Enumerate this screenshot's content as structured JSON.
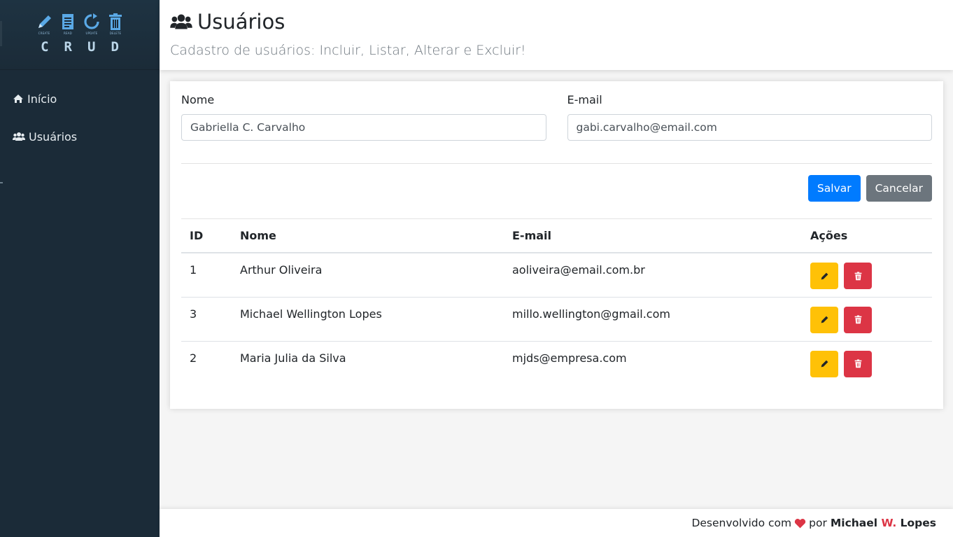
{
  "sidebar": {
    "logo": {
      "letters": [
        "C",
        "R",
        "U",
        "D"
      ],
      "captions": [
        "CREATE",
        "READ",
        "UPDATE",
        "DELETE"
      ]
    },
    "items": [
      {
        "label": "Início",
        "icon": "home-icon"
      },
      {
        "label": "Usuários",
        "icon": "users-icon"
      }
    ]
  },
  "header": {
    "title": "Usuários",
    "subtitle": "Cadastro de usuários: Incluir, Listar, Alterar e Excluir!"
  },
  "form": {
    "name_label": "Nome",
    "name_value": "Gabriella C. Carvalho",
    "email_label": "E-mail",
    "email_value": "gabi.carvalho@email.com",
    "save_label": "Salvar",
    "cancel_label": "Cancelar"
  },
  "table": {
    "headers": [
      "ID",
      "Nome",
      "E-mail",
      "Ações"
    ],
    "rows": [
      {
        "id": "1",
        "nome": "Arthur Oliveira",
        "email": "aoliveira@email.com.br"
      },
      {
        "id": "3",
        "nome": "Michael Wellington Lopes",
        "email": "millo.wellington@gmail.com"
      },
      {
        "id": "2",
        "nome": "Maria Julia da Silva",
        "email": "mjds@empresa.com"
      }
    ]
  },
  "footer": {
    "prefix": "Desenvolvido com",
    "by": "por",
    "author_first": "Michael",
    "author_middle": "W.",
    "author_last": "Lopes"
  },
  "colors": {
    "sidebar_bg": "#1b2b38",
    "primary": "#007bff",
    "secondary": "#6c757d",
    "warning": "#ffc107",
    "danger": "#dc3545"
  }
}
